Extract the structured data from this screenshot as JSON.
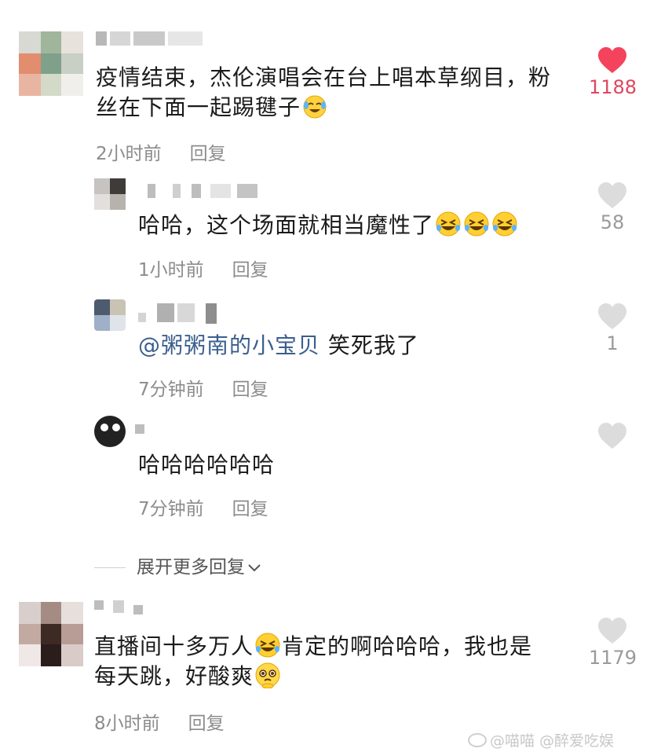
{
  "comments": [
    {
      "text": [
        "疫情结束，杰伦演唱会在台上唱本草纲目，粉",
        "丝在下面一起踢毽子"
      ],
      "time": "2小时前",
      "reply": "回复",
      "likes": "1188",
      "liked": true,
      "emoji": "crying-laughing-emoji"
    },
    {
      "text": "哈哈，这个场面就相当魔性了",
      "time": "1小时前",
      "reply": "回复",
      "likes": "58",
      "emoji": "rolling-laughing-emoji"
    },
    {
      "mention": "@粥粥南的小宝贝",
      "text": " 笑死我了",
      "time": "7分钟前",
      "reply": "回复",
      "likes": "1"
    },
    {
      "text": "哈哈哈哈哈哈",
      "time": "7分钟前",
      "reply": "回复",
      "likes": ""
    },
    {
      "text_a": "直播间十多万人",
      "text_b": "肯定的啊哈哈哈，我也是",
      "text_c": "每天跳，好酸爽",
      "time": "8小时前",
      "reply": "回复",
      "likes": "1179",
      "emoji": "pleading-emoji"
    }
  ],
  "expand_label": "展开更多回复",
  "watermark": "@喵喵  @醉爱吃娱",
  "colors": {
    "like_active": "#f4435c",
    "like_inactive": "#d9d9d9",
    "meta": "#8c8c8c",
    "mention": "#3b5f8f"
  }
}
